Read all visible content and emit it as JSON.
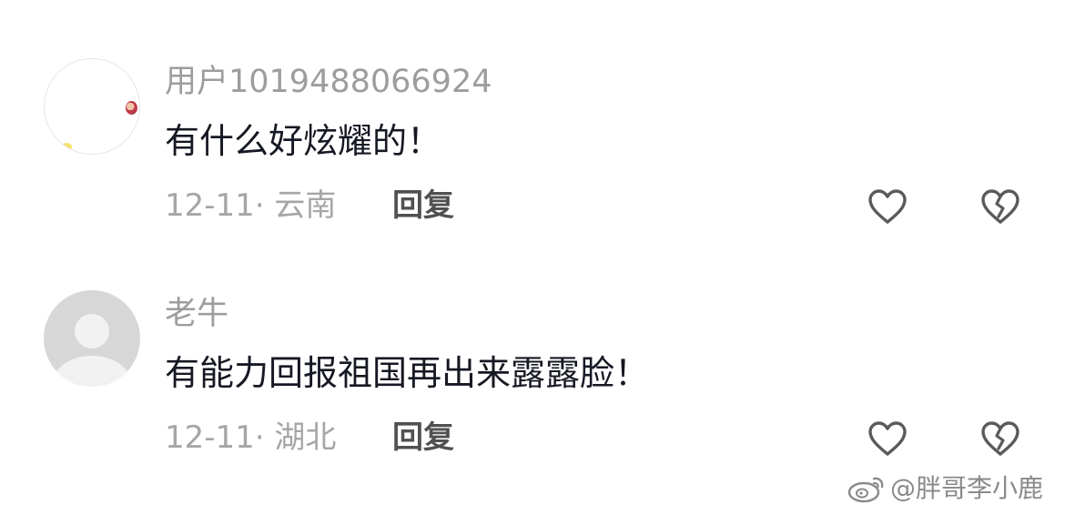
{
  "comments": [
    {
      "username": "用户1019488066924",
      "text": "有什么好炫耀的！",
      "date": "12-11",
      "separator": "·",
      "location": "云南",
      "reply_label": "回复"
    },
    {
      "username": "老牛",
      "text": "有能力回报祖国再出来露露脸！",
      "date": "12-11",
      "separator": "·",
      "location": "湖北",
      "reply_label": "回复"
    }
  ],
  "watermark": {
    "text": "@胖哥李小鹿",
    "icon": "weibo-icon"
  },
  "colors": {
    "username": "#9d9d9d",
    "text": "#161823",
    "meta": "#a6a6a6",
    "reply": "#505050",
    "icon": "#5a5a5a"
  }
}
